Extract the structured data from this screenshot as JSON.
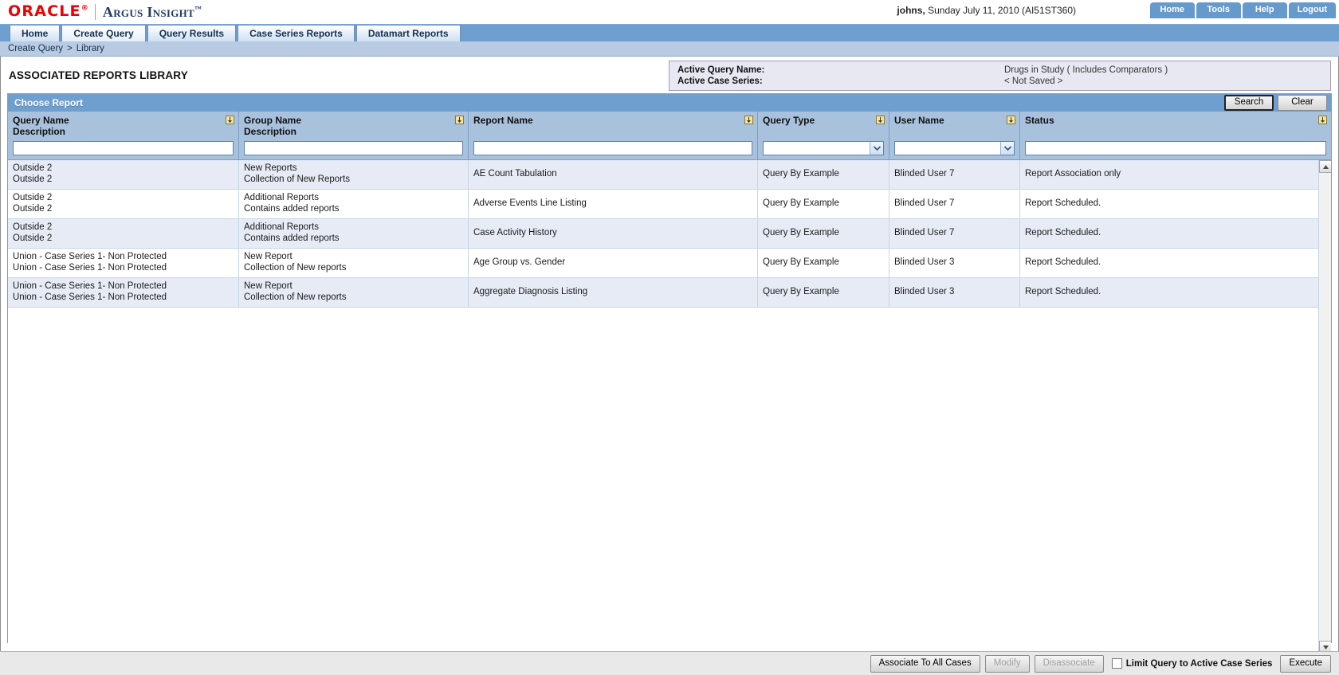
{
  "brand": {
    "oracle": "ORACLE",
    "oracle_mark": "®",
    "product": "Argus Insight",
    "product_mark": "™"
  },
  "header": {
    "user": "johns,",
    "session": " Sunday July 11, 2010 (AI51ST360)",
    "links": [
      {
        "label": "Home",
        "name": "toplink-home"
      },
      {
        "label": "Tools",
        "name": "toplink-tools"
      },
      {
        "label": "Help",
        "name": "toplink-help"
      },
      {
        "label": "Logout",
        "name": "toplink-logout"
      }
    ]
  },
  "tabs": [
    {
      "label": "Home",
      "active": false
    },
    {
      "label": "Create Query",
      "active": true
    },
    {
      "label": "Query Results",
      "active": false
    },
    {
      "label": "Case Series Reports",
      "active": false
    },
    {
      "label": "Datamart Reports",
      "active": false
    }
  ],
  "breadcrumb": {
    "first": "Create Query",
    "separator": ">",
    "last": "Library"
  },
  "page": {
    "title": "ASSOCIATED REPORTS LIBRARY"
  },
  "active_panel": {
    "query_name_label": "Active Query Name:",
    "query_name_value": "Drugs in Study ( Includes Comparators )",
    "case_series_label": "Active Case Series:",
    "case_series_value": "< Not Saved >"
  },
  "panel": {
    "title": "Choose Report",
    "search_label": "Search",
    "clear_label": "Clear"
  },
  "columns": [
    {
      "title": "Query Name",
      "subtitle": "Description",
      "filter": true,
      "field": "text",
      "value": ""
    },
    {
      "title": "Group Name",
      "subtitle": "Description",
      "filter": true,
      "field": "text",
      "value": ""
    },
    {
      "title": "Report Name",
      "subtitle": "",
      "filter": true,
      "field": "text",
      "value": ""
    },
    {
      "title": "Query Type",
      "subtitle": "",
      "filter": true,
      "field": "select",
      "value": ""
    },
    {
      "title": "User Name",
      "subtitle": "",
      "filter": true,
      "field": "select",
      "value": ""
    },
    {
      "title": "Status",
      "subtitle": "",
      "filter": true,
      "field": "text",
      "value": ""
    }
  ],
  "rows": [
    {
      "query_name": "Outside 2",
      "query_description": "Outside 2",
      "group_name": "New Reports",
      "group_description": "Collection of New Reports",
      "report_name": "AE Count Tabulation",
      "query_type": "Query By Example",
      "user_name": "Blinded User 7",
      "status": "Report Association only"
    },
    {
      "query_name": "Outside 2",
      "query_description": "Outside 2",
      "group_name": "Additional Reports",
      "group_description": "Contains added reports",
      "report_name": "Adverse Events Line Listing",
      "query_type": "Query By Example",
      "user_name": "Blinded User 7",
      "status": "Report Scheduled."
    },
    {
      "query_name": "Outside 2",
      "query_description": "Outside 2",
      "group_name": "Additional Reports",
      "group_description": "Contains added reports",
      "report_name": "Case Activity History",
      "query_type": "Query By Example",
      "user_name": "Blinded User 7",
      "status": "Report Scheduled."
    },
    {
      "query_name": "Union - Case Series 1- Non Protected",
      "query_description": "Union - Case Series 1- Non Protected",
      "group_name": "New Report",
      "group_description": "Collection of New reports",
      "report_name": "Age Group vs. Gender",
      "query_type": "Query By Example",
      "user_name": "Blinded User 3",
      "status": "Report Scheduled."
    },
    {
      "query_name": "Union - Case Series 1- Non Protected",
      "query_description": "Union - Case Series 1- Non Protected",
      "group_name": "New Report",
      "group_description": "Collection of New reports",
      "report_name": "Aggregate Diagnosis Listing",
      "query_type": "Query By Example",
      "user_name": "Blinded User 3",
      "status": "Report Scheduled."
    }
  ],
  "footer": {
    "associate_label": "Associate To All Cases",
    "modify_label": "Modify",
    "disassociate_label": "Disassociate",
    "limit_label": "Limit Query to Active Case Series",
    "limit_checked": false,
    "execute_label": "Execute"
  },
  "colors": {
    "oracle_red": "#f00000",
    "brand_blue": "#1f3a63",
    "header_blue": "#6f9fcf",
    "col_header": "#a8c2de",
    "row_alt": "#e7ebf5",
    "breadcrumb": "#b8cbe2"
  }
}
